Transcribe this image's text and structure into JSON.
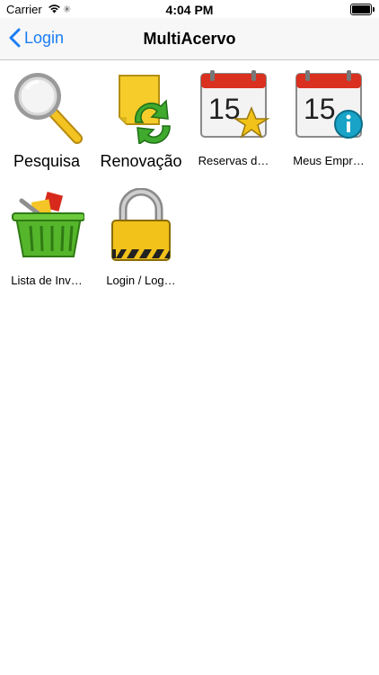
{
  "status": {
    "carrier": "Carrier",
    "time": "4:04 PM"
  },
  "nav": {
    "back_label": "Login",
    "title": "MultiAcervo"
  },
  "items": [
    {
      "label": "Pesquisa",
      "icon": "magnifier-icon"
    },
    {
      "label": "Renovação",
      "icon": "renew-document-icon"
    },
    {
      "label": "Reservas d…",
      "icon": "calendar-star-icon"
    },
    {
      "label": "Meus Empr…",
      "icon": "calendar-info-icon"
    },
    {
      "label": "Lista de Inv…",
      "icon": "basket-icon"
    },
    {
      "label": "Login / Log…",
      "icon": "padlock-icon"
    }
  ],
  "colors": {
    "accent": "#1a7ef5",
    "calendar_red": "#d9301f",
    "star_yellow": "#f2c21a",
    "info_blue": "#18a3c7",
    "basket_green": "#55b52b"
  },
  "calendar_day": "15"
}
